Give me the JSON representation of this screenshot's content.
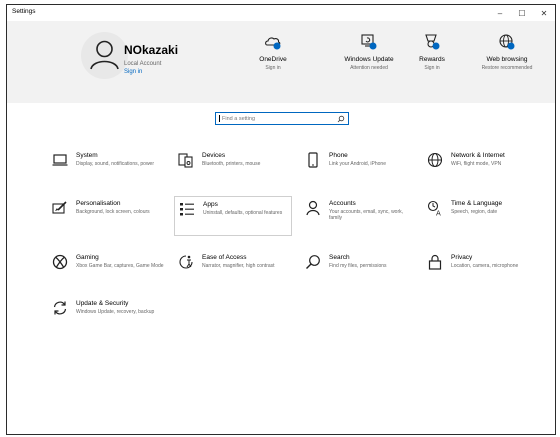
{
  "window": {
    "title": "Settings",
    "minimize": "–",
    "maximize": "☐",
    "close": "✕"
  },
  "account": {
    "name": "NOkazaki",
    "type": "Local Account",
    "sign_in": "Sign in"
  },
  "quick_links": [
    {
      "label": "OneDrive",
      "sub": "Sign in",
      "icon": "onedrive-icon"
    },
    {
      "label": "Windows Update",
      "sub": "Attention needed",
      "icon": "windows-update-icon"
    },
    {
      "label": "Rewards",
      "sub": "Sign in",
      "icon": "rewards-icon"
    },
    {
      "label": "Web browsing",
      "sub": "Restore recommended",
      "icon": "web-browsing-icon"
    }
  ],
  "search": {
    "placeholder": "Find a setting"
  },
  "tiles": [
    {
      "name": "System",
      "desc": "Display, sound, notifications, power",
      "icon": "laptop-icon"
    },
    {
      "name": "Devices",
      "desc": "Bluetooth, printers, mouse",
      "icon": "devices-icon"
    },
    {
      "name": "Phone",
      "desc": "Link your Android, iPhone",
      "icon": "phone-icon"
    },
    {
      "name": "Network & Internet",
      "desc": "WiFi, flight mode, VPN",
      "icon": "globe-icon"
    },
    {
      "name": "Personalisation",
      "desc": "Background, lock screen, colours",
      "icon": "personalisation-icon"
    },
    {
      "name": "Apps",
      "desc": "Uninstall, defaults, optional features",
      "icon": "apps-icon"
    },
    {
      "name": "Accounts",
      "desc": "Your accounts, email, sync, work, family",
      "icon": "person-icon"
    },
    {
      "name": "Time & Language",
      "desc": "Speech, region, date",
      "icon": "time-language-icon"
    },
    {
      "name": "Gaming",
      "desc": "Xbox Game Bar, captures, Game Mode",
      "icon": "xbox-icon"
    },
    {
      "name": "Ease of Access",
      "desc": "Narrator, magnifier, high contrast",
      "icon": "ease-of-access-icon"
    },
    {
      "name": "Search",
      "desc": "Find my files, permissions",
      "icon": "search-icon"
    },
    {
      "name": "Privacy",
      "desc": "Location, camera, microphone",
      "icon": "lock-icon"
    },
    {
      "name": "Update & Security",
      "desc": "Windows Update, recovery, backup",
      "icon": "sync-icon"
    }
  ],
  "colors": {
    "accent": "#0067c0",
    "header_bg": "#f2f2f2"
  }
}
